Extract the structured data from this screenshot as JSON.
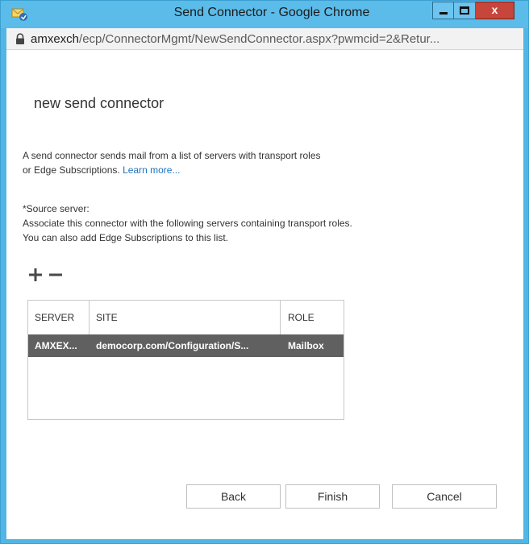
{
  "window": {
    "title": "Send Connector - Google Chrome",
    "close_glyph": "x",
    "icons": [
      "app-icon",
      "minimize-icon",
      "maximize-icon",
      "close-icon"
    ]
  },
  "address_bar": {
    "host": "amxexch",
    "path": "/ecp/ConnectorMgmt/NewSendConnector.aspx?pwmcid=2&Retur..."
  },
  "page": {
    "title": "new send connector",
    "description": "A send connector sends mail from a list of servers with transport roles or Edge Subscriptions.",
    "learn_more": "Learn more...",
    "source_label": "*Source server:",
    "source_help": "Associate this connector with the following servers containing transport roles. You can also add Edge Subscriptions to this list."
  },
  "toolbar": {
    "icons": [
      "add-icon",
      "remove-icon"
    ]
  },
  "grid": {
    "columns": [
      "SERVER",
      "SITE",
      "ROLE"
    ],
    "rows": [
      {
        "server": "AMXEX...",
        "site": "democorp.com/Configuration/S...",
        "role": "Mailbox"
      }
    ]
  },
  "buttons": {
    "back": "Back",
    "finish": "Finish",
    "cancel": "Cancel"
  },
  "colors": {
    "title_bar": "#5bbce9",
    "close_button": "#c7463b",
    "selected_row": "#606060",
    "link": "#1e73be"
  }
}
